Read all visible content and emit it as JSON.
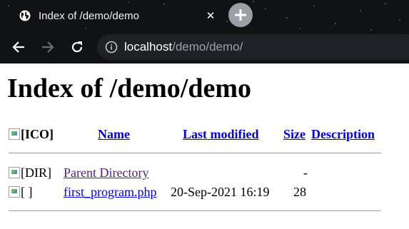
{
  "browser": {
    "tab_title": "Index of /demo/demo",
    "close_glyph": "✕",
    "url_host": "localhost",
    "url_path": "/demo/demo/"
  },
  "page": {
    "heading": "Index of /demo/demo",
    "columns": {
      "icon_alt": "[ICO]",
      "name": "Name",
      "last_modified": "Last modified",
      "size": "Size",
      "description": "Description"
    },
    "rows": [
      {
        "icon_alt": "[DIR]",
        "name": "Parent Directory",
        "last_modified": "",
        "size": "-",
        "description": ""
      },
      {
        "icon_alt": "[ ]",
        "name": "first_program.php",
        "last_modified": "20-Sep-2021 16:19",
        "size": "28",
        "description": ""
      }
    ]
  },
  "colors": {
    "link": "#0000ee",
    "visited_link": "#551a8b",
    "chrome_bg": "#111214",
    "omnibox_bg": "#202124"
  },
  "icons": [
    "globe-icon",
    "close-icon",
    "plus-icon",
    "back-arrow-icon",
    "forward-arrow-icon",
    "reload-icon",
    "info-icon",
    "broken-image-icon"
  ]
}
